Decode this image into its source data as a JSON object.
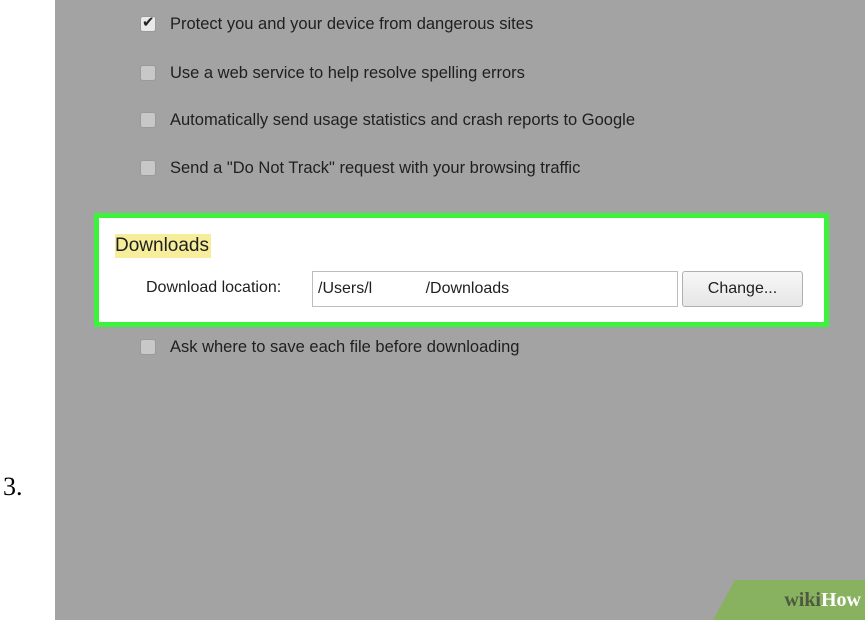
{
  "step": {
    "number": "3."
  },
  "privacy": {
    "options": [
      {
        "label": "Protect you and your device from dangerous sites",
        "checked": true
      },
      {
        "label": "Use a web service to help resolve spelling errors",
        "checked": false
      },
      {
        "label": "Automatically send usage statistics and crash reports to Google",
        "checked": false
      },
      {
        "label": "Send a \"Do Not Track\" request with your browsing traffic",
        "checked": false
      }
    ]
  },
  "downloads": {
    "title": "Downloads",
    "location_label": "Download location:",
    "location_value": "/Users/l            /Downloads",
    "change_button": "Change...",
    "ask_option": {
      "label": "Ask where to save each file before downloading",
      "checked": false
    }
  },
  "watermark": {
    "wiki": "wiki",
    "how": "How"
  },
  "colors": {
    "background": "#a3a3a3",
    "highlight_border": "#3cf23c",
    "title_highlight": "#f6ee9b",
    "watermark_green": "#88b160"
  },
  "icons": {
    "checked": "check-mark-icon",
    "unchecked": "empty-checkbox-icon"
  }
}
